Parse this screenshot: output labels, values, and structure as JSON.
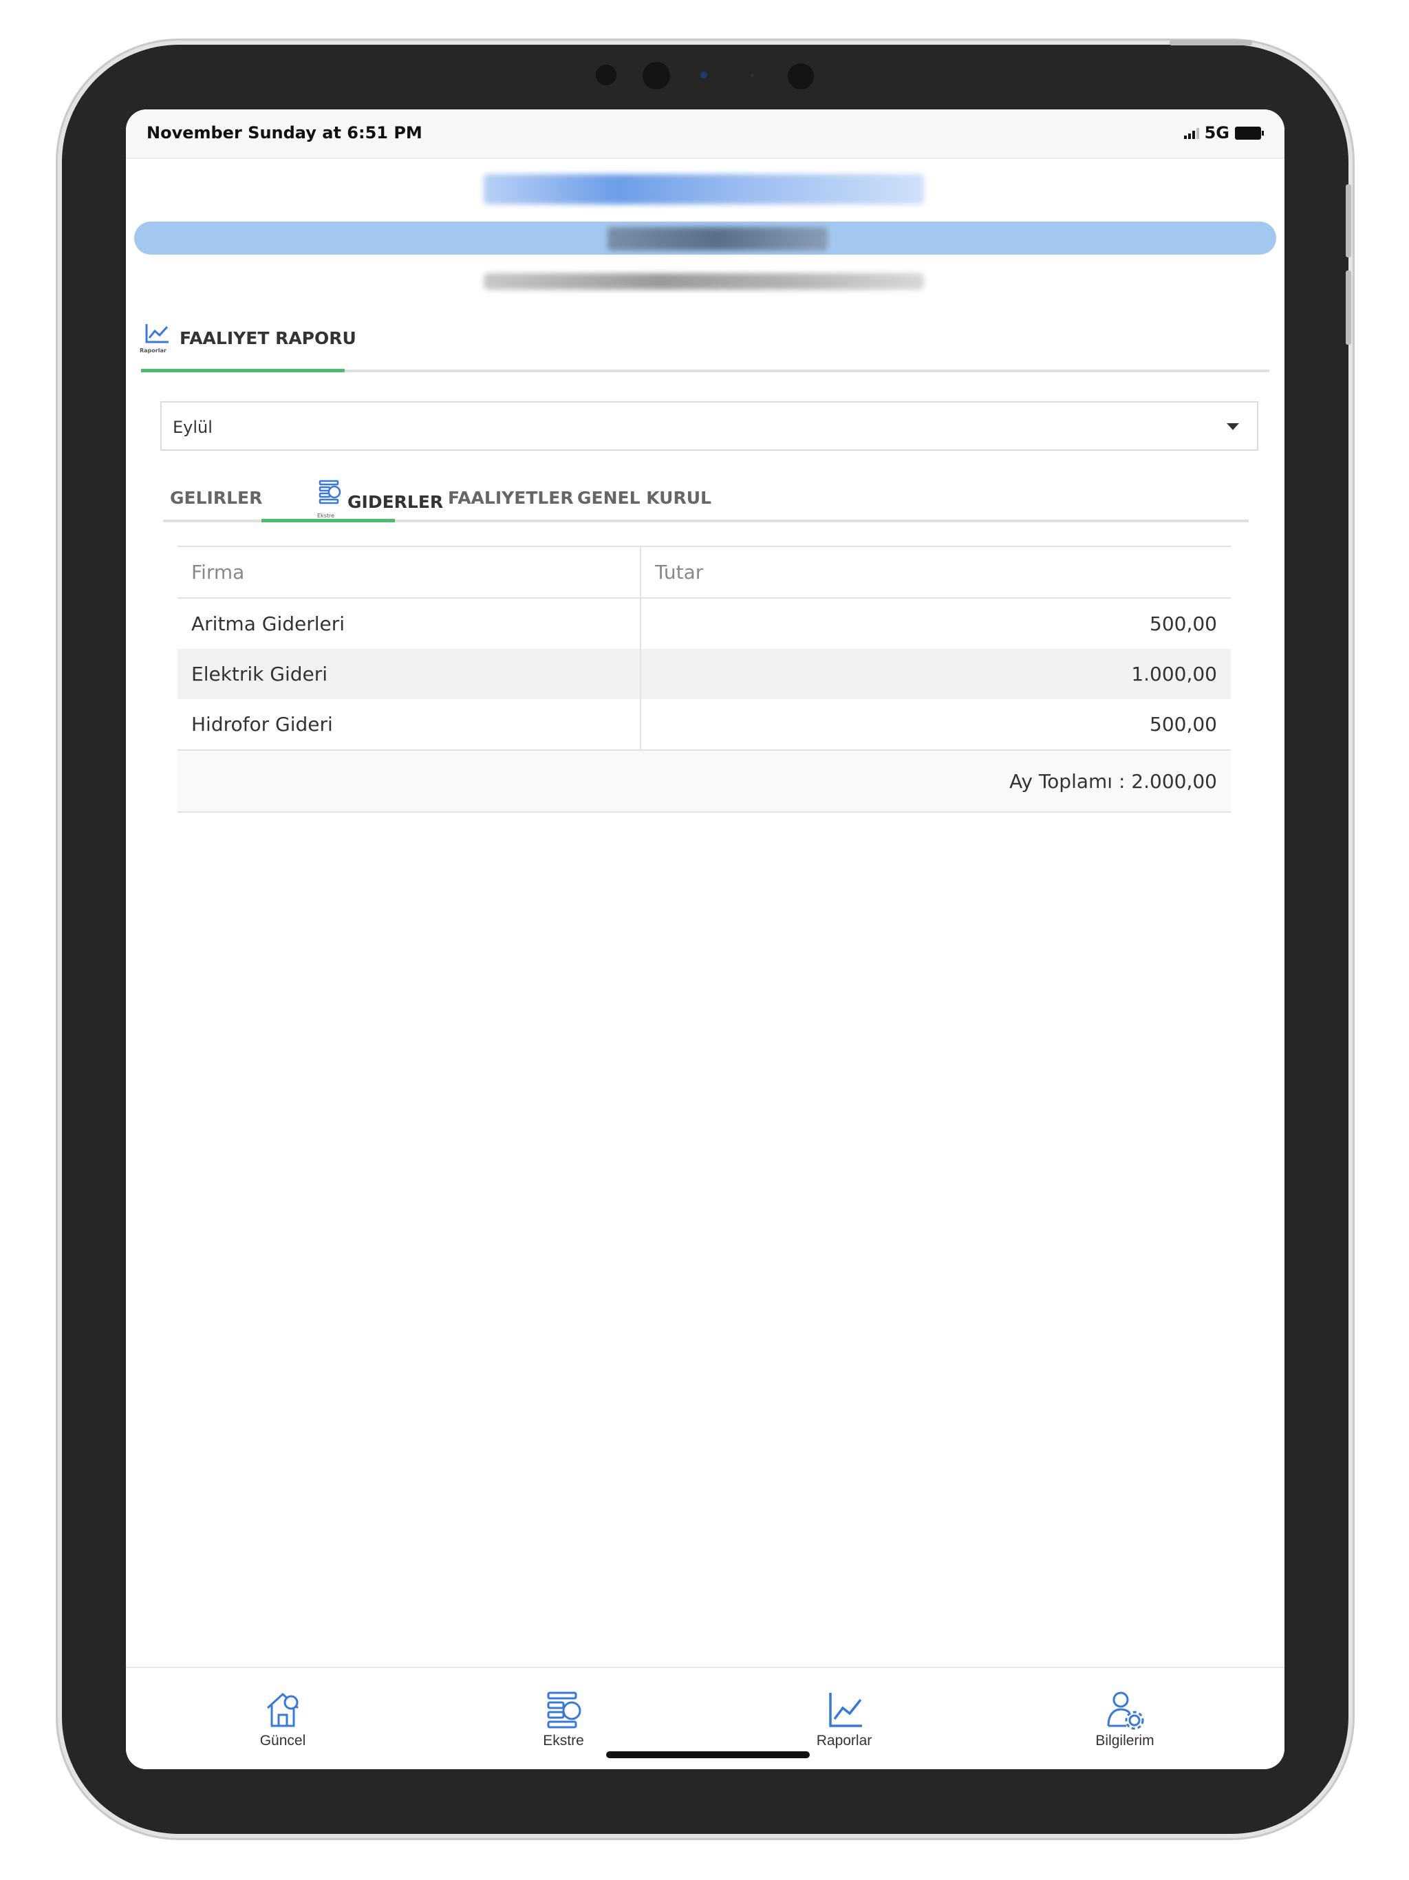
{
  "status_bar": {
    "time": "November Sunday at 6:51 PM",
    "network": "5G"
  },
  "header": {
    "title": "MANOLYA SİTESİ YÖNETİMİ",
    "user": "SONRAN ÖZGELİK",
    "subtitle": ""
  },
  "section_tab": {
    "label": "FAALIYET RAPORU",
    "icon_label": "Raporlar"
  },
  "month_select": {
    "value": "Eylül"
  },
  "subtabs": {
    "tabs": [
      "GELIRLER",
      "GIDERLER",
      "FAALIYETLER",
      "GENEL KURUL"
    ],
    "active": "GIDERLER",
    "active_icon_label": "Ekstre"
  },
  "table": {
    "columns": [
      "Firma",
      "Tutar"
    ],
    "rows": [
      {
        "firma": "Aritma Giderleri",
        "tutar": "500,00"
      },
      {
        "firma": "Elektrik Gideri",
        "tutar": "1.000,00"
      },
      {
        "firma": "Hidrofor Gideri",
        "tutar": "500,00"
      }
    ],
    "total": "Ay Toplamı : 2.000,00"
  },
  "bottom_nav": {
    "items": [
      {
        "label": "Güncel",
        "icon": "home-money-icon"
      },
      {
        "label": "Ekstre",
        "icon": "statement-icon"
      },
      {
        "label": "Raporlar",
        "icon": "chart-icon"
      },
      {
        "label": "Bilgilerim",
        "icon": "user-settings-icon"
      }
    ]
  },
  "colors": {
    "accent_green": "#4cbb6c",
    "icon_blue": "#3a78d8",
    "user_band": "#a3c8f0"
  }
}
